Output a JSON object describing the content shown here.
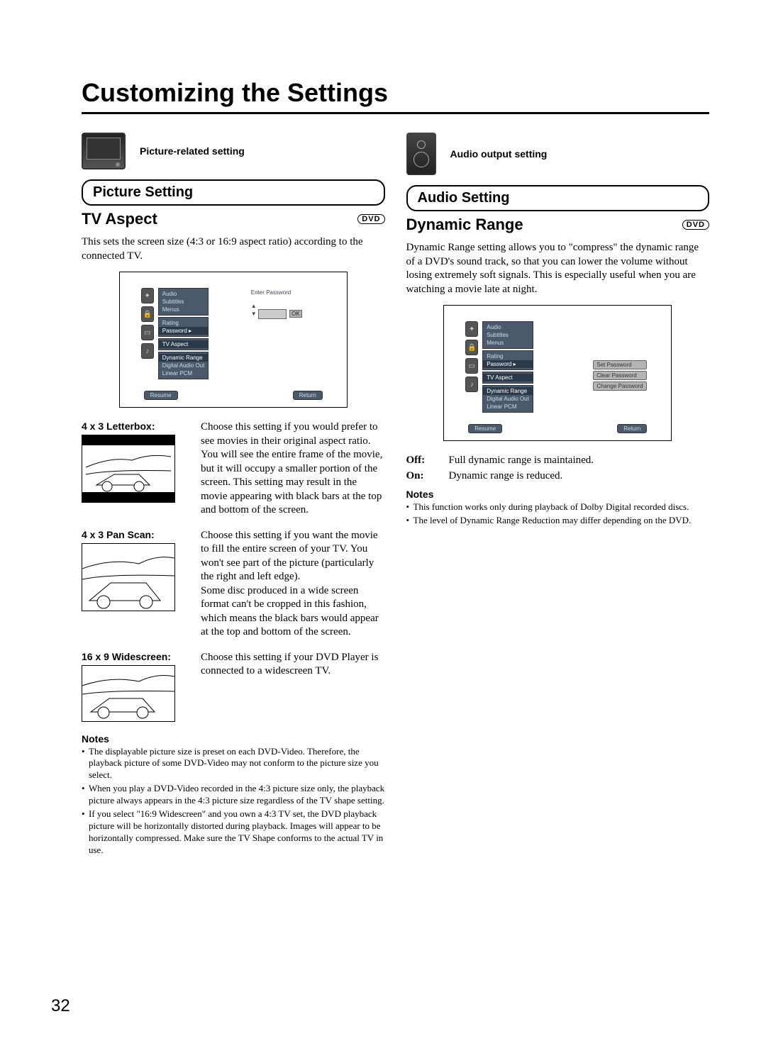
{
  "page_number": "32",
  "title": "Customizing the Settings",
  "left": {
    "icon_caption": "Picture-related setting",
    "pill": "Picture Setting",
    "subhead": "TV Aspect",
    "badge": "DVD",
    "intro": "This sets the screen size (4:3 or 16:9 aspect ratio) according to the connected TV.",
    "osd": {
      "g1": [
        "Audio",
        "Subtitles",
        "Menus"
      ],
      "g2": [
        "Rating",
        "Password"
      ],
      "g3": [
        "TV Aspect"
      ],
      "g4": [
        "Dynamic Range",
        "Digital Audio Out",
        "Linear PCM"
      ],
      "right_label": "Enter Password",
      "ok": "OK",
      "resume": "Resume",
      "return": "Return"
    },
    "opt1": {
      "title": "4 x 3 Letterbox:",
      "text": "Choose this setting if you would prefer to see movies in their original aspect ratio. You will see the entire frame of the movie, but it will occupy a smaller portion of the screen. This setting may result in the movie appearing with black bars at the top and bottom of the screen."
    },
    "opt2": {
      "title": "4 x 3 Pan Scan:",
      "text": "Choose this setting if you want the movie to fill the entire screen of your TV. You won't see part of the picture (particularly the right and left edge).\nSome disc produced in a wide screen format can't be cropped in this fashion, which means the black bars would appear at the top and bottom of the screen."
    },
    "opt3": {
      "title": "16 x 9 Widescreen:",
      "text": "Choose this setting if your DVD Player is connected to a widescreen TV."
    },
    "notes_h": "Notes",
    "notes": [
      "The displayable picture size is preset on each DVD-Video. Therefore, the playback picture of some DVD-Video may not conform to the picture size you select.",
      "When you play a DVD-Video recorded in the 4:3 picture size only, the playback picture always appears in the 4:3 picture size regardless of the TV shape setting.",
      "If you select \"16:9 Widescreen\" and you own a 4:3 TV set, the DVD playback picture will be horizontally distorted during playback. Images will appear to be horizontally compressed. Make sure the TV Shape conforms to the actual TV in use."
    ]
  },
  "right": {
    "icon_caption": "Audio output setting",
    "pill": "Audio Setting",
    "subhead": "Dynamic Range",
    "badge": "DVD",
    "intro": "Dynamic Range setting allows you to \"compress\" the dynamic range of a DVD's sound track, so that you can lower the volume without losing extremely soft signals. This is especially useful when you are watching a movie late at night.",
    "osd": {
      "g1": [
        "Audio",
        "Subtitles",
        "Menus"
      ],
      "g2": [
        "Rating",
        "Password"
      ],
      "g3": [
        "TV Aspect"
      ],
      "g4": [
        "Dynamic Range",
        "Digital Audio Out",
        "Linear PCM"
      ],
      "sub": [
        "Set Password",
        "Clear Password",
        "Change Password"
      ],
      "resume": "Resume",
      "return": "Return"
    },
    "def_off_l": "Off:",
    "def_off_t": "Full dynamic range is maintained.",
    "def_on_l": "On:",
    "def_on_t": "Dynamic range is reduced.",
    "notes_h": "Notes",
    "notes": [
      "This function works only during playback of Dolby Digital recorded discs.",
      "The level of Dynamic Range Reduction may differ depending on the DVD."
    ]
  }
}
